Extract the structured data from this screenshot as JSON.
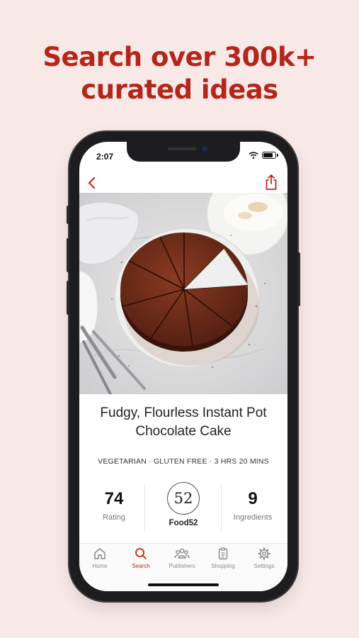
{
  "headline": {
    "line1": "Search over 300k+",
    "line2": "curated ideas"
  },
  "status_bar": {
    "time": "2:07"
  },
  "nav": {
    "back_icon": "chevron-left-icon",
    "share_icon": "share-icon"
  },
  "hero_image": {
    "subject": "chocolate-cake-photo"
  },
  "recipe": {
    "title_line1": "Fudgy, Flourless Instant Pot",
    "title_line2": "Chocolate Cake",
    "tags": "VEGETARIAN · GLUTEN FREE · 3 HRS 20 MINS"
  },
  "stats": {
    "rating_value": "74",
    "rating_label": "Rating",
    "publisher_logo": "52",
    "publisher_name": "Food52",
    "ingredients_value": "9",
    "ingredients_label": "Ingredients"
  },
  "tabs": [
    {
      "label": "Home",
      "icon": "home-icon"
    },
    {
      "label": "Search",
      "icon": "search-icon"
    },
    {
      "label": "Publishers",
      "icon": "publishers-icon"
    },
    {
      "label": "Shopping",
      "icon": "shopping-list-icon"
    },
    {
      "label": "Settings",
      "icon": "gear-icon"
    }
  ],
  "colors": {
    "accent": "#c0281c",
    "background": "#f8e9e7"
  }
}
